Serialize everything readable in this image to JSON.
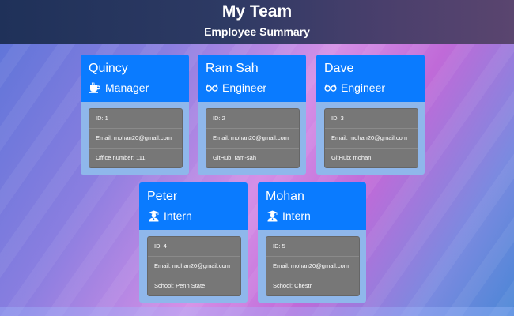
{
  "header": {
    "title": "My Team",
    "subtitle": "Employee Summary"
  },
  "employees": [
    {
      "name": "Quincy",
      "role": "Manager",
      "role_icon": "coffee-icon",
      "id": "ID: 1",
      "email": "Email: mohan20@gmail.com",
      "extra": "Office number: 111"
    },
    {
      "name": "Ram Sah",
      "role": "Engineer",
      "role_icon": "glasses-icon",
      "id": "ID: 2",
      "email": "Email: mohan20@gmail.com",
      "extra": "GitHub: ram-sah"
    },
    {
      "name": "Dave",
      "role": "Engineer",
      "role_icon": "glasses-icon",
      "id": "ID: 3",
      "email": "Email: mohan20@gmail.com",
      "extra": "GitHub: mohan"
    },
    {
      "name": "Peter",
      "role": "Intern",
      "role_icon": "graduate-icon",
      "id": "ID: 4",
      "email": "Email: mohan20@gmail.com",
      "extra": "School: Penn State"
    },
    {
      "name": "Mohan",
      "role": "Intern",
      "role_icon": "graduate-icon",
      "id": "ID: 5",
      "email": "Email: mohan20@gmail.com",
      "extra": "School: Chestr"
    }
  ],
  "colors": {
    "card_header": "#0a7bff",
    "card_body": "#8fb7eb",
    "info_box": "#777777",
    "header_bg": "#2e3a64"
  }
}
